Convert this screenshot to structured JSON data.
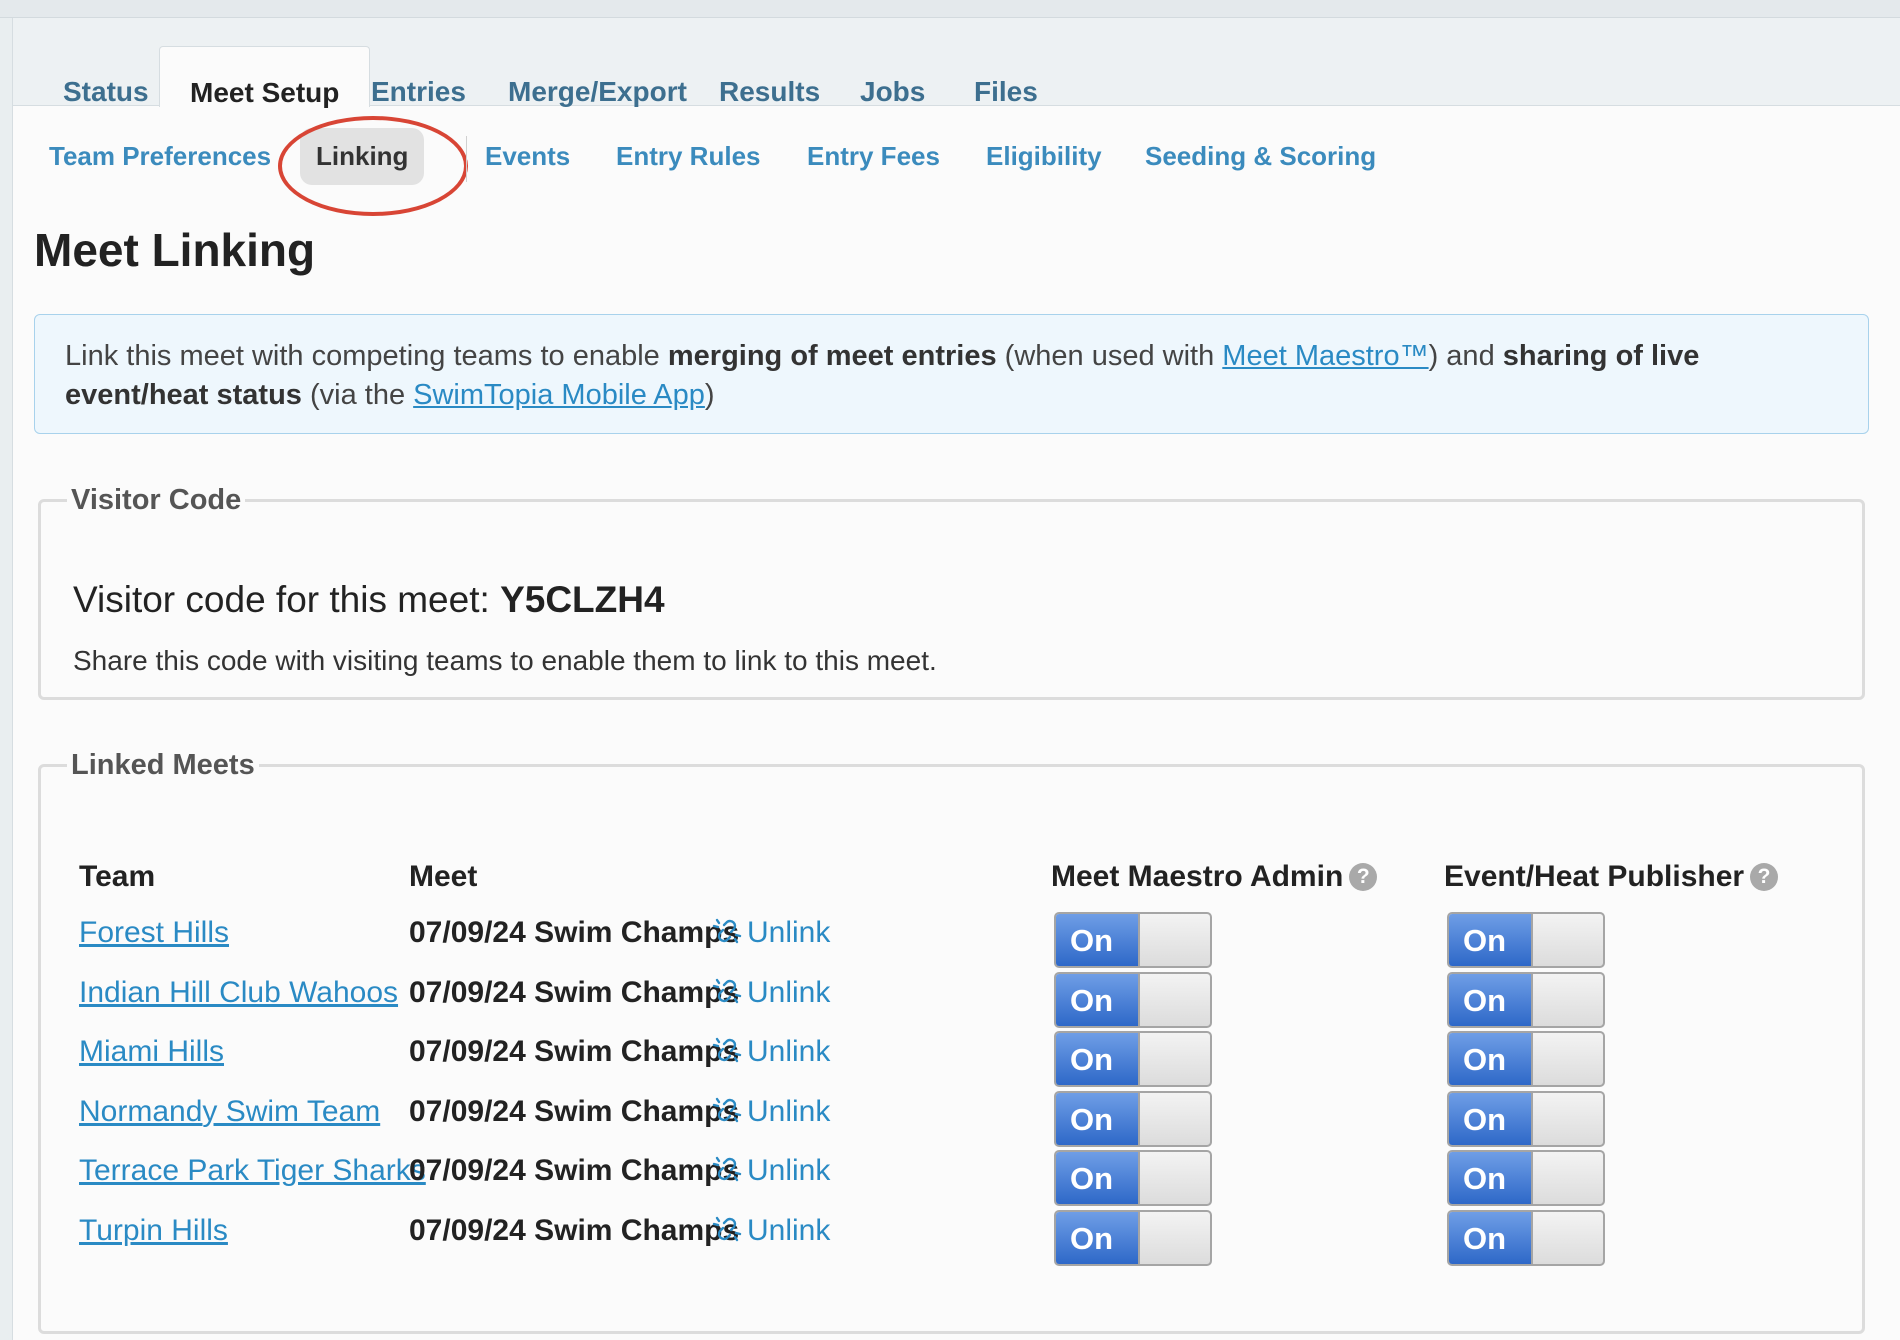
{
  "tabs": [
    {
      "label": "Status"
    },
    {
      "label": "Meet Setup"
    },
    {
      "label": "Entries"
    },
    {
      "label": "Merge/Export"
    },
    {
      "label": "Results"
    },
    {
      "label": "Jobs"
    },
    {
      "label": "Files"
    }
  ],
  "subnav": [
    {
      "label": "Team Preferences"
    },
    {
      "label": "Linking"
    },
    {
      "label": "Events"
    },
    {
      "label": "Entry Rules"
    },
    {
      "label": "Entry Fees"
    },
    {
      "label": "Eligibility"
    },
    {
      "label": "Seeding & Scoring"
    }
  ],
  "page": {
    "title": "Meet Linking"
  },
  "info": {
    "t1": "Link this meet with competing teams to enable ",
    "b1": "merging of meet entries",
    "t2": " (when used with ",
    "link1": "Meet Maestro™",
    "t3": ") and ",
    "b2": "sharing of live event/heat status",
    "t4": " (via the ",
    "link2": "SwimTopia Mobile App",
    "t5": ")"
  },
  "visitor": {
    "legend": "Visitor Code",
    "label": "Visitor code for this meet: ",
    "code": "Y5CLZH4",
    "description": "Share this code with visiting teams to enable them to link to this meet."
  },
  "linked": {
    "legend": "Linked Meets",
    "headers": {
      "team": "Team",
      "meet": "Meet",
      "admin": "Meet Maestro Admin",
      "publisher": "Event/Heat Publisher",
      "help": "?"
    },
    "unlink_label": "Unlink",
    "toggle_label": "On",
    "rows": [
      {
        "team": "Forest Hills",
        "meet": "07/09/24 Swim Champs",
        "admin": "On",
        "publisher": "On"
      },
      {
        "team": "Indian Hill Club Wahoos",
        "meet": "07/09/24 Swim Champs",
        "admin": "On",
        "publisher": "On"
      },
      {
        "team": "Miami Hills",
        "meet": "07/09/24 Swim Champs",
        "admin": "On",
        "publisher": "On"
      },
      {
        "team": "Normandy Swim Team",
        "meet": "07/09/24 Swim Champs",
        "admin": "On",
        "publisher": "On"
      },
      {
        "team": "Terrace Park Tiger Sharks",
        "meet": "07/09/24 Swim Champs",
        "admin": "On",
        "publisher": "On"
      },
      {
        "team": "Turpin Hills",
        "meet": "07/09/24 Swim Champs",
        "admin": "On",
        "publisher": "On"
      }
    ]
  },
  "colors": {
    "link": "#2a8ac4",
    "highlight": "#d84535",
    "toggle_on": "#2e68c8"
  }
}
